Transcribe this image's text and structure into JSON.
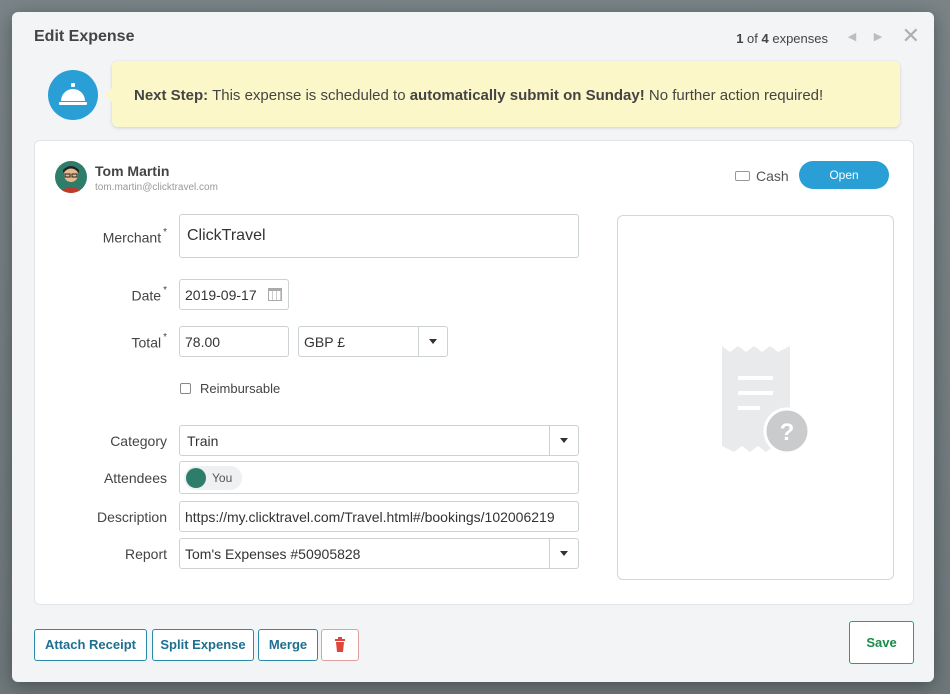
{
  "modal": {
    "title": "Edit Expense",
    "pager": {
      "current": "1",
      "of_text": " of ",
      "total": "4",
      "suffix": " expenses"
    }
  },
  "banner": {
    "lead": "Next Step:",
    "text_before": " This expense is scheduled to ",
    "emphasis": "automatically submit on Sunday!",
    "text_after": " No further action required!"
  },
  "user": {
    "name": "Tom Martin",
    "email": "tom.martin@clicktravel.com"
  },
  "payment": {
    "method": "Cash",
    "status_button": "Open"
  },
  "form": {
    "merchant": {
      "label": "Merchant",
      "required": "*",
      "value": "ClickTravel"
    },
    "date": {
      "label": "Date",
      "required": "*",
      "value": "2019-09-17"
    },
    "total": {
      "label": "Total",
      "required": "*",
      "amount": "78.00",
      "currency": "GBP £"
    },
    "reimbursable": {
      "label": "Reimbursable",
      "checked": false
    },
    "category": {
      "label": "Category",
      "value": "Train"
    },
    "attendees": {
      "label": "Attendees",
      "chip": "You"
    },
    "description": {
      "label": "Description",
      "value": "https://my.clicktravel.com/Travel.html#/bookings/102006219"
    },
    "report": {
      "label": "Report",
      "value": "Tom's Expenses #50905828"
    }
  },
  "actions": {
    "attach_receipt": "Attach Receipt",
    "split_expense": "Split Expense",
    "merge": "Merge",
    "save": "Save"
  },
  "colors": {
    "accent": "#2a9fd6",
    "banner": "#fcf7c8",
    "save": "#27a35a",
    "delete": "#e0443a"
  }
}
